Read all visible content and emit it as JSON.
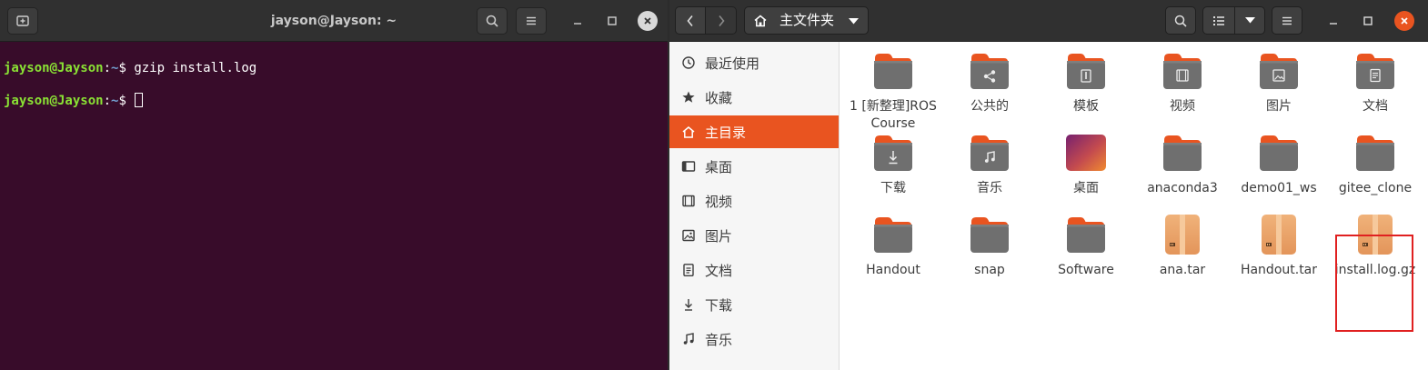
{
  "terminal": {
    "title": "jayson@Jayson: ~",
    "lines": [
      {
        "user": "jayson@Jayson",
        "sep": ":",
        "path": "~",
        "symbol": "$ ",
        "command": "gzip install.log"
      },
      {
        "user": "jayson@Jayson",
        "sep": ":",
        "path": "~",
        "symbol": "$ ",
        "command": ""
      }
    ],
    "colors": {
      "background": "#380c2a",
      "user": "#8ae234",
      "path": "#729fcf"
    }
  },
  "files": {
    "path_label": "主文件夹",
    "sidebar": [
      {
        "label": "最近使用",
        "icon": "clock-icon",
        "active": false
      },
      {
        "label": "收藏",
        "icon": "star-icon",
        "active": false
      },
      {
        "label": "主目录",
        "icon": "home-icon",
        "active": true
      },
      {
        "label": "桌面",
        "icon": "desktop-icon",
        "active": false
      },
      {
        "label": "视频",
        "icon": "video-icon",
        "active": false
      },
      {
        "label": "图片",
        "icon": "picture-icon",
        "active": false
      },
      {
        "label": "文档",
        "icon": "document-icon",
        "active": false
      },
      {
        "label": "下载",
        "icon": "download-icon",
        "active": false
      },
      {
        "label": "音乐",
        "icon": "music-icon",
        "active": false
      }
    ],
    "items": [
      {
        "label": "1 [新整理]ROS Course",
        "icon": "folder-icon"
      },
      {
        "label": "公共的",
        "icon": "share-folder-icon"
      },
      {
        "label": "模板",
        "icon": "template-folder-icon"
      },
      {
        "label": "视频",
        "icon": "video-folder-icon"
      },
      {
        "label": "图片",
        "icon": "picture-folder-icon"
      },
      {
        "label": "文档",
        "icon": "document-folder-icon"
      },
      {
        "label": "下载",
        "icon": "download-folder-icon"
      },
      {
        "label": "音乐",
        "icon": "music-folder-icon"
      },
      {
        "label": "桌面",
        "icon": "desktop-folder-icon"
      },
      {
        "label": "anaconda3",
        "icon": "folder-icon"
      },
      {
        "label": "demo01_ws",
        "icon": "folder-icon"
      },
      {
        "label": "gitee_clone",
        "icon": "folder-icon"
      },
      {
        "label": "Handout",
        "icon": "folder-icon"
      },
      {
        "label": "snap",
        "icon": "folder-icon"
      },
      {
        "label": "Software",
        "icon": "folder-icon"
      },
      {
        "label": "ana.tar",
        "icon": "archive-icon"
      },
      {
        "label": "Handout.tar",
        "icon": "archive-icon"
      },
      {
        "label": "install.log.gz",
        "icon": "archive-icon",
        "highlighted": true
      }
    ],
    "colors": {
      "accent": "#e95420",
      "folder": "#6f6f6f",
      "folder_tab": "#e95420",
      "archive": "#e9a46a",
      "highlight": "#e02020"
    }
  }
}
